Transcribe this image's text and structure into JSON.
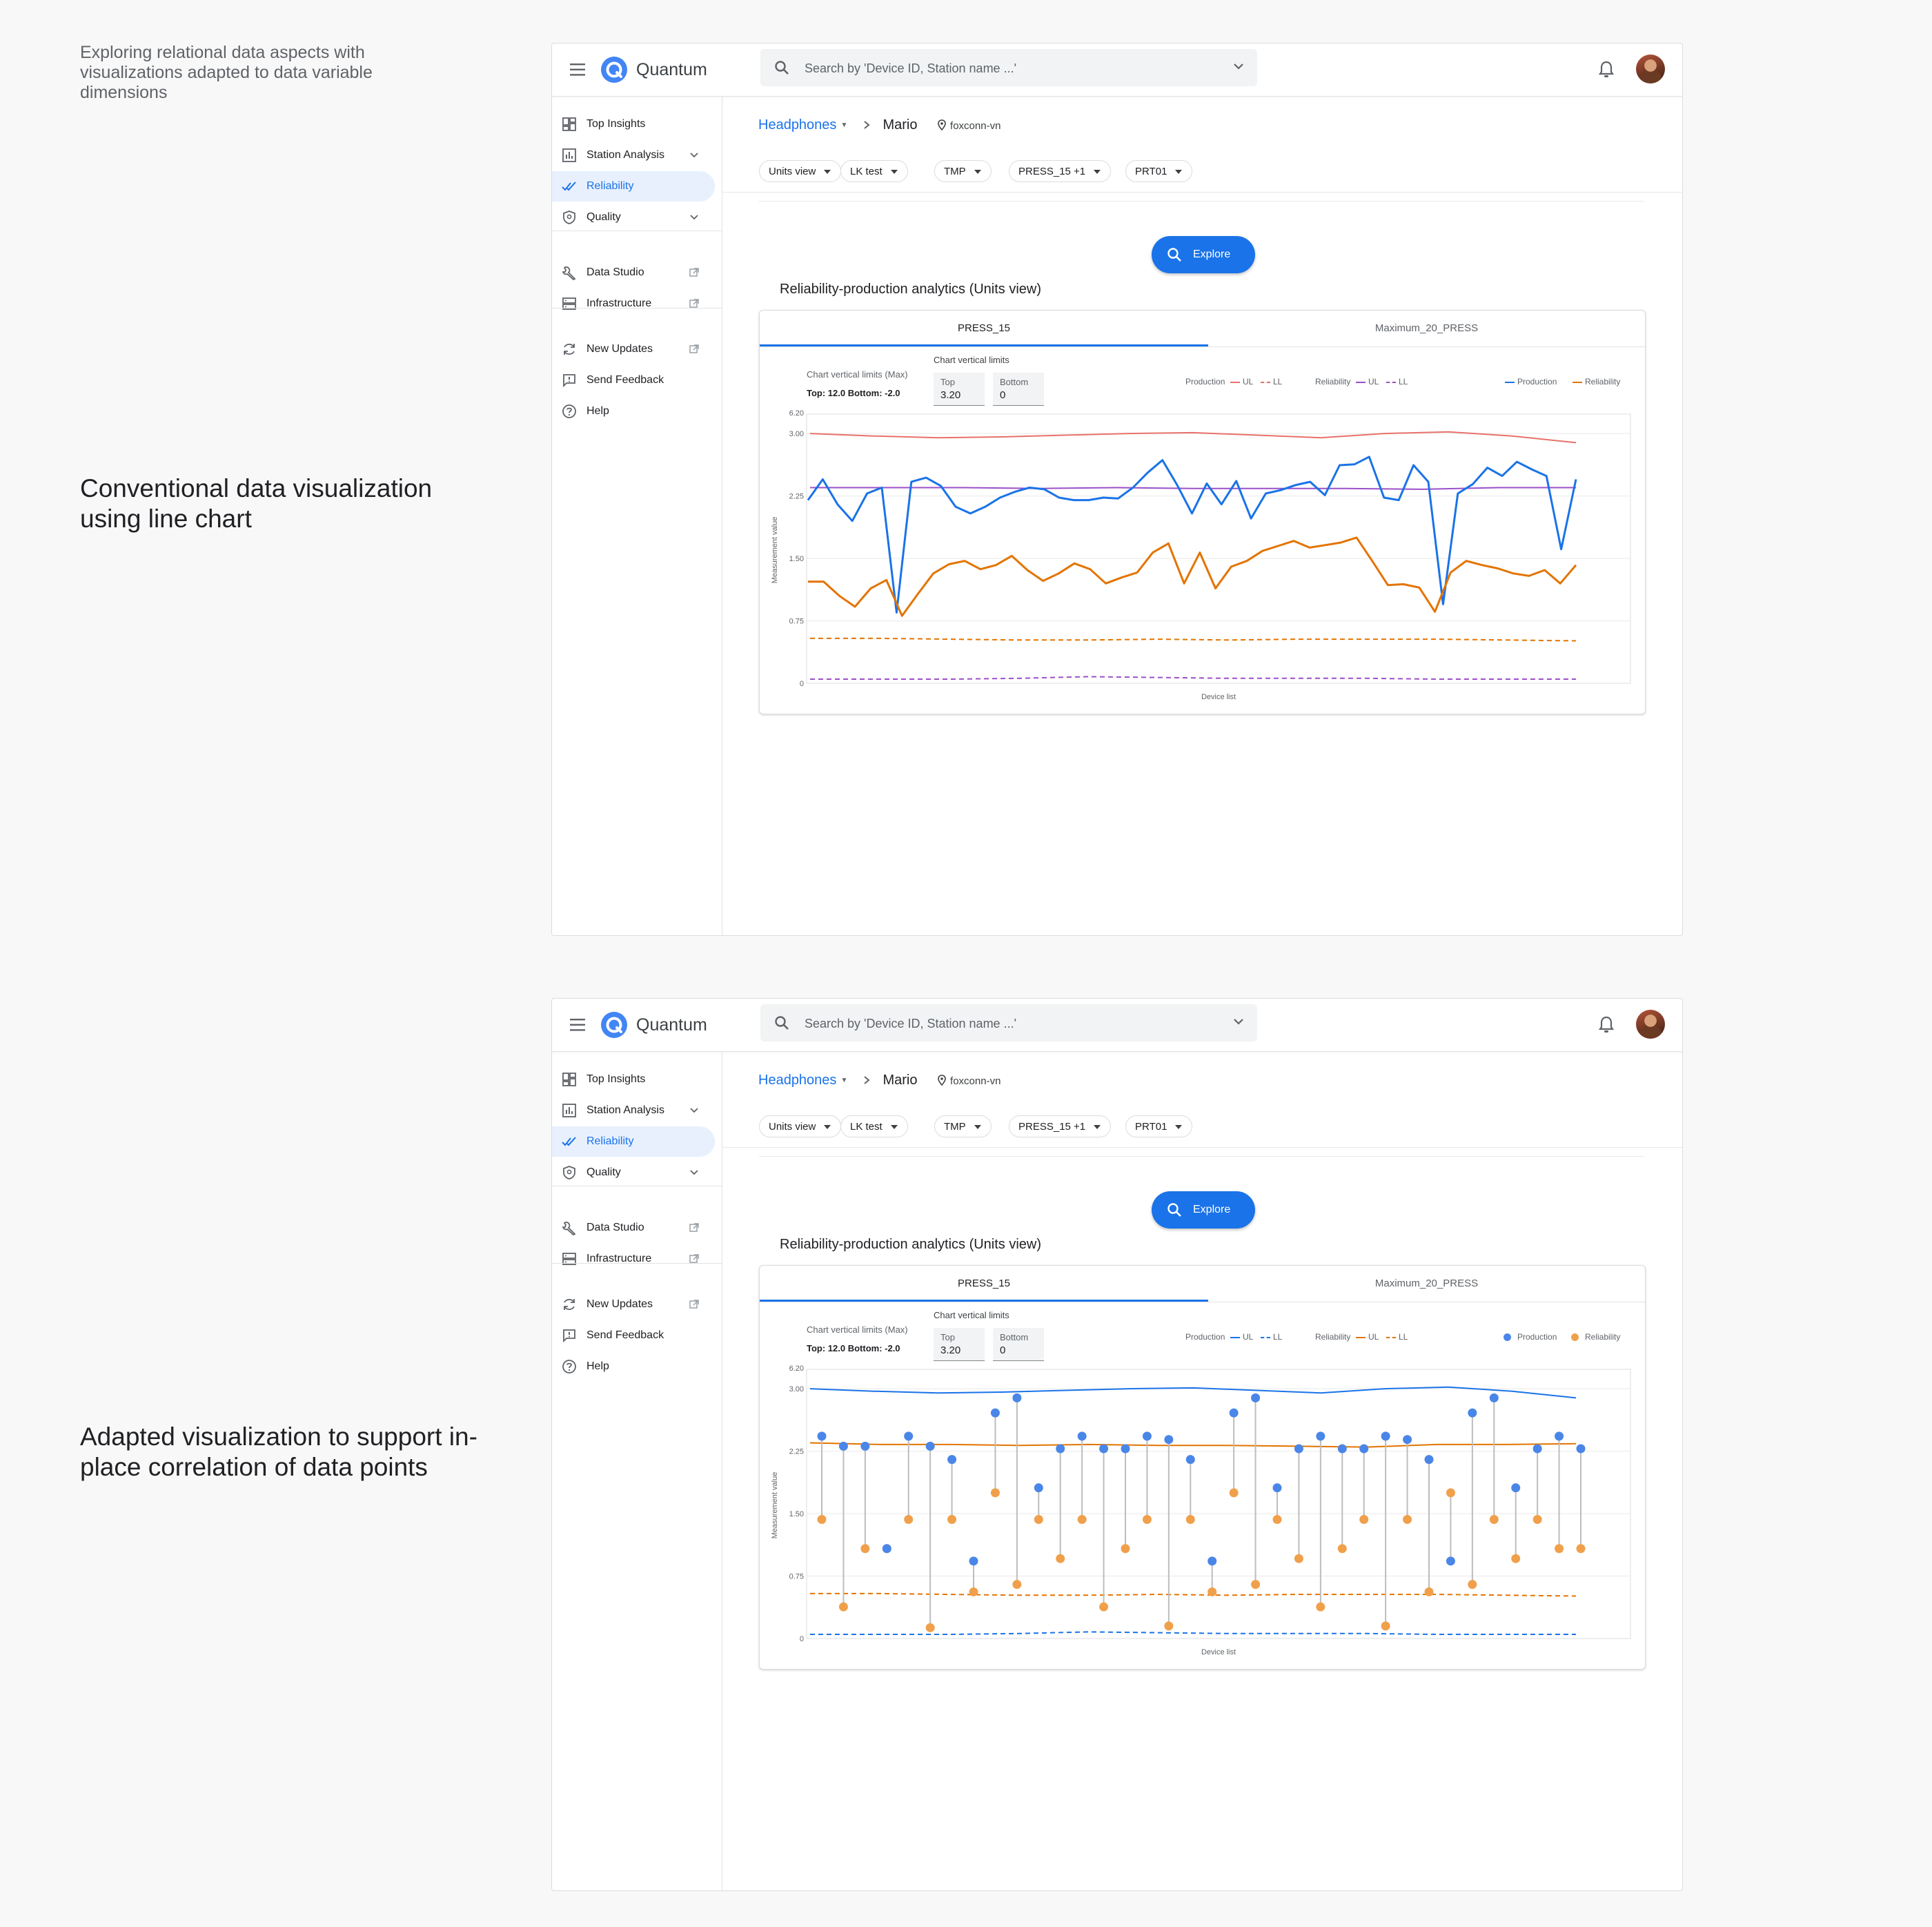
{
  "captions": {
    "intro": "Exploring relational data aspects with visualizations adapted to data variable dimensions",
    "first": "Conventional data visualization using line chart",
    "second": "Adapted visualization to support in-place correlation of data points"
  },
  "app": {
    "name": "Quantum",
    "search_placeholder": "Search by 'Device ID, Station name ...'"
  },
  "sidebar": {
    "items": [
      {
        "label": "Top Insights",
        "icon": "dashboard-icon"
      },
      {
        "label": "Station Analysis",
        "icon": "bar-chart-icon"
      },
      {
        "label": "Reliability",
        "icon": "double-check-icon"
      },
      {
        "label": "Quality",
        "icon": "shield-icon"
      },
      {
        "label": "Data Studio",
        "icon": "wrench-icon"
      },
      {
        "label": "Infrastructure",
        "icon": "server-icon"
      },
      {
        "label": "New Updates",
        "icon": "refresh-icon"
      },
      {
        "label": "Send Feedback",
        "icon": "feedback-icon"
      },
      {
        "label": "Help",
        "icon": "help-icon"
      }
    ]
  },
  "breadcrumb": {
    "product": "Headphones",
    "page": "Mario",
    "location": "foxconn-vn"
  },
  "filters": [
    "Units view",
    "LK test",
    "TMP",
    "PRESS_15 +1",
    "PRT01"
  ],
  "explore_label": "Explore",
  "section_title": "Reliability-production analytics (Units view)",
  "tabs": [
    "PRESS_15",
    "Maximum_20_PRESS"
  ],
  "limits": {
    "title": "Chart vertical limits",
    "max_label": "Chart vertical limits (Max)",
    "max_values": "Top: 12.0  Bottom: -2.0",
    "top_label": "Top",
    "top_value": "3.20",
    "bottom_label": "Bottom",
    "bottom_value": "0"
  },
  "legend": {
    "production": "Production",
    "ul": "UL",
    "ll": "LL",
    "reliability": "Reliability"
  },
  "colors": {
    "production": "#1a73e8",
    "reliability": "#e37400",
    "prod_limit_line": "#e8716b",
    "rel_limit_line": "#9c4fc9",
    "dot_production": "#4a86e8",
    "dot_reliability": "#f0a04b",
    "accent": "#1a73e8"
  },
  "chart_data": [
    {
      "type": "line",
      "xlabel": "Device list",
      "ylabel": "Measurement value",
      "y_ticks": [
        "0",
        "0.75",
        "1.50",
        "2.25",
        "3.00",
        "6.20"
      ],
      "series": [
        {
          "name": "Production",
          "values": [
            2.2,
            2.45,
            2.15,
            1.95,
            2.28,
            2.35,
            0.85,
            2.42,
            2.47,
            2.37,
            2.12,
            2.04,
            2.12,
            2.23,
            2.3,
            2.35,
            2.33,
            2.23,
            2.2,
            2.2,
            2.23,
            2.22,
            2.35,
            2.53,
            2.68,
            2.38,
            2.04,
            2.4,
            2.15,
            2.43,
            1.98,
            2.28,
            2.32,
            2.38,
            2.42,
            2.26,
            2.62,
            2.63,
            2.72,
            2.23,
            2.2,
            2.62,
            2.42,
            0.95,
            2.28,
            2.39,
            2.59,
            2.49,
            2.66,
            2.57,
            2.49,
            1.61,
            2.45
          ]
        },
        {
          "name": "Reliability",
          "values": [
            1.22,
            1.22,
            1.05,
            0.92,
            1.14,
            1.24,
            0.81,
            1.07,
            1.32,
            1.43,
            1.47,
            1.37,
            1.42,
            1.53,
            1.36,
            1.23,
            1.32,
            1.44,
            1.37,
            1.2,
            1.27,
            1.33,
            1.57,
            1.68,
            1.2,
            1.57,
            1.14,
            1.4,
            1.47,
            1.59,
            1.65,
            1.71,
            1.63,
            1.66,
            1.69,
            1.75,
            1.47,
            1.18,
            1.19,
            1.15,
            0.86,
            1.33,
            1.47,
            1.42,
            1.38,
            1.32,
            1.29,
            1.36,
            1.2,
            1.42
          ]
        },
        {
          "name": "Production UL",
          "values": [
            3.0,
            2.97,
            2.95,
            2.96,
            2.98,
            3.0,
            3.01,
            2.98,
            2.95,
            3.0,
            3.02,
            2.97,
            2.89
          ],
          "style": "solid"
        },
        {
          "name": "Reliability UL",
          "values": [
            2.35,
            2.35,
            2.35,
            2.34,
            2.35,
            2.34,
            2.34,
            2.34,
            2.33,
            2.35,
            2.35
          ],
          "style": "solid"
        },
        {
          "name": "Production LL",
          "values": [
            0.54,
            0.54,
            0.53,
            0.52,
            0.52,
            0.53,
            0.52,
            0.53,
            0.53,
            0.53,
            0.52,
            0.51
          ],
          "style": "dashed"
        },
        {
          "name": "Reliability LL",
          "values": [
            0.05,
            0.05,
            0.05,
            0.06,
            0.08,
            0.07,
            0.06,
            0.06,
            0.06,
            0.05,
            0.05,
            0.05
          ],
          "style": "dashed"
        }
      ],
      "ylim": [
        0,
        3.2
      ]
    },
    {
      "type": "scatter",
      "xlabel": "Device list",
      "ylabel": "Measurement value",
      "y_ticks": [
        "0",
        "0.75",
        "1.50",
        "2.25",
        "3.00",
        "6.20"
      ],
      "series": [
        {
          "name": "Production",
          "values": [
            2.43,
            2.31,
            2.31,
            1.08,
            2.43,
            2.31,
            2.15,
            0.93,
            2.71,
            2.89,
            1.81,
            2.28,
            2.43,
            2.28,
            2.28,
            2.43,
            2.39,
            2.15,
            0.93,
            2.71,
            2.89,
            1.81,
            2.28,
            2.43,
            2.28,
            2.28,
            2.43,
            2.39,
            2.15,
            0.93,
            2.71,
            2.89,
            1.81,
            2.28,
            2.43,
            2.28
          ]
        },
        {
          "name": "Reliability",
          "values": [
            1.43,
            0.38,
            1.08,
            1.08,
            1.43,
            0.13,
            1.43,
            0.56,
            1.75,
            0.65,
            1.43,
            0.96,
            1.43,
            0.38,
            1.08,
            1.43,
            0.15,
            1.43,
            0.56,
            1.75,
            0.65,
            1.43,
            0.96,
            0.38,
            1.08,
            1.43,
            0.15,
            1.43,
            0.56,
            1.75,
            0.65,
            1.43,
            0.96,
            1.43,
            1.08,
            1.08
          ]
        },
        {
          "name": "Production UL",
          "values": [
            3.0,
            2.97,
            2.95,
            2.96,
            2.98,
            3.0,
            3.01,
            2.98,
            2.95,
            3.0,
            3.02,
            2.97,
            2.89
          ],
          "style": "solid"
        },
        {
          "name": "Reliability UL",
          "values": [
            2.35,
            2.33,
            2.33,
            2.32,
            2.33,
            2.32,
            2.32,
            2.31,
            2.3,
            2.33,
            2.33,
            2.34
          ],
          "style": "solid"
        },
        {
          "name": "Production LL",
          "values": [
            0.54,
            0.54,
            0.53,
            0.52,
            0.52,
            0.53,
            0.52,
            0.53,
            0.53,
            0.53,
            0.52,
            0.51
          ],
          "style": "dashed"
        },
        {
          "name": "Reliability LL",
          "values": [
            0.05,
            0.05,
            0.05,
            0.06,
            0.08,
            0.07,
            0.06,
            0.06,
            0.06,
            0.05,
            0.05,
            0.05
          ],
          "style": "dashed"
        }
      ],
      "ylim": [
        0,
        3.2
      ]
    }
  ]
}
